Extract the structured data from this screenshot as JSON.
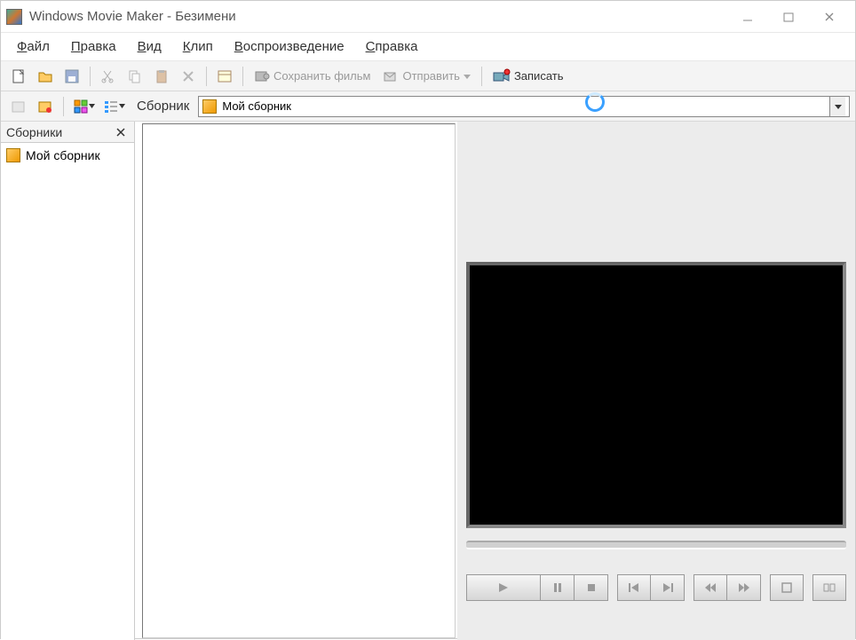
{
  "titlebar": {
    "app_title": "Windows Movie Maker - Безимени"
  },
  "menu": {
    "file": "Файл",
    "edit": "Правка",
    "view": "Вид",
    "clip": "Клип",
    "playback": "Воспроизведение",
    "help": "Справка"
  },
  "toolbar": {
    "save_movie": "Сохранить фильм",
    "send": "Отправить",
    "record": "Записать"
  },
  "collectionsBar": {
    "label": "Сборник",
    "selected": "Мой сборник"
  },
  "sidebar": {
    "title": "Сборники",
    "items": [
      {
        "label": "Мой сборник"
      }
    ]
  },
  "icons": {
    "new": "new-file-icon",
    "open": "open-folder-icon",
    "save": "save-icon",
    "cut": "cut-icon",
    "copy": "copy-icon",
    "paste": "paste-icon",
    "delete": "delete-icon",
    "properties": "properties-icon",
    "save_movie": "save-movie-icon",
    "send": "send-icon",
    "record": "record-camera-icon",
    "new_collection": "new-collection-icon",
    "record_narration": "narration-icon",
    "view_thumb": "thumbnail-view-icon",
    "view_list": "list-view-icon"
  }
}
